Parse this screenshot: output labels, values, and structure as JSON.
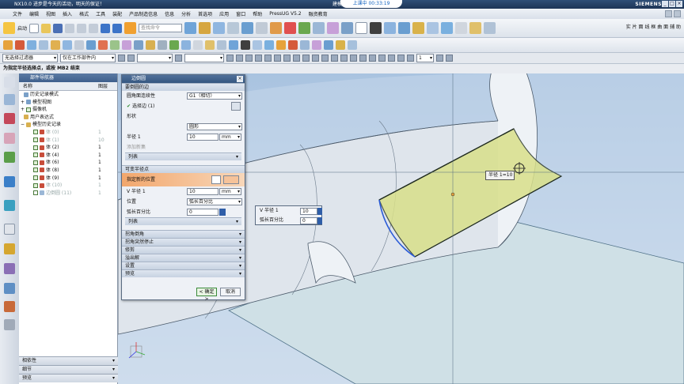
{
  "titlebar": {
    "left_text": "NX10.0 进步是今天的活动，明天的保证！",
    "center_text": "建模 - [_model4.prt（修改的）]",
    "badge": "上课中 00:33:19",
    "brand": "SIEMENS"
  },
  "menu": [
    "文件",
    "编辑",
    "视图",
    "插入",
    "格式",
    "工具",
    "装配",
    "产品制造信息",
    "信息",
    "分析",
    "首选项",
    "应用",
    "窗口",
    "帮助",
    "PressUG V5.2",
    "融资教育"
  ],
  "toolbar": {
    "start_label": "启动",
    "search_placeholder": "查找命令",
    "right_label": "实 片 面 线 框 曲 面 辅 助"
  },
  "filterbar": {
    "filter": "无选择过滤器",
    "scope": "仅在工作部件内",
    "count": "1"
  },
  "status": "为指定半径选择点，或按 MB2 结束",
  "navigator": {
    "title": "部件导航器",
    "col_name": "名称",
    "col_layer": "图层",
    "items": [
      {
        "label": "历史记录模式",
        "layer": "",
        "state": "normal"
      },
      {
        "label": "模型视图",
        "layer": "",
        "state": "normal"
      },
      {
        "label": "摄像机",
        "layer": "",
        "state": "normal"
      },
      {
        "label": "用户表达式",
        "layer": "",
        "state": "normal"
      },
      {
        "label": "模型历史记录",
        "layer": "",
        "state": "normal"
      },
      {
        "label": "体 (0)",
        "layer": "1",
        "state": "gray"
      },
      {
        "label": "体 (1)",
        "layer": "10",
        "state": "gray"
      },
      {
        "label": "体 (2)",
        "layer": "1",
        "state": "normal"
      },
      {
        "label": "体 (4)",
        "layer": "1",
        "state": "normal"
      },
      {
        "label": "体 (6)",
        "layer": "1",
        "state": "normal"
      },
      {
        "label": "体 (8)",
        "layer": "1",
        "state": "normal"
      },
      {
        "label": "体 (9)",
        "layer": "1",
        "state": "normal"
      },
      {
        "label": "体 (10)",
        "layer": "1",
        "state": "gray"
      },
      {
        "label": "边倒圆 (11)",
        "layer": "1",
        "state": "gray"
      }
    ],
    "bottom": [
      "相依性",
      "细节",
      "预览"
    ]
  },
  "dialog": {
    "title": "边倒圆",
    "sec_edge": "要倒圆的边",
    "continuity_label": "圆角面连续性",
    "continuity_value": "G1（相切）",
    "select_edge": "选择边 (1)",
    "shape_label": "形状",
    "shape_value": "圆形",
    "radius_label": "半径 1",
    "radius_value": "10",
    "unit": "mm",
    "add_new": "添加新集",
    "list": "列表",
    "sec_var": "可变半径点",
    "new_pos": "指定新的位置",
    "vradius_label": "V 半径 1",
    "vradius_value": "10",
    "position_label": "位置",
    "position_value": "弧长百分比",
    "arc_label": "弧长百分比",
    "arc_value": "0",
    "list2": "列表",
    "sections": [
      "拐角倒角",
      "拐角突然停止",
      "修剪",
      "溢出解",
      "设置",
      "预览"
    ],
    "ok": "< 确定 >",
    "cancel": "取消"
  },
  "popup": {
    "vradius_label": "V 半径 1",
    "vradius_value": "10",
    "arc_label": "弧长百分比",
    "arc_value": "0"
  },
  "radius_tag": "半径 1=10"
}
